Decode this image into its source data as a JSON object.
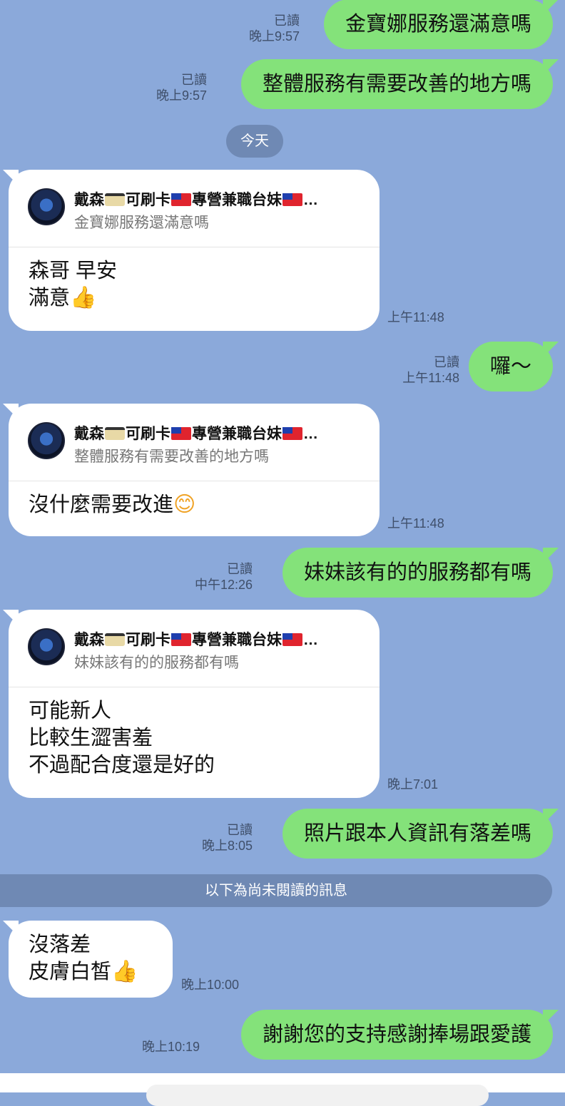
{
  "messages": {
    "m1": {
      "text": "金寶娜服務還滿意嗎",
      "read": "已讀",
      "time": "晚上9:57"
    },
    "m2": {
      "text": "整體服務有需要改善的地方嗎",
      "read": "已讀",
      "time": "晚上9:57"
    },
    "date_divider": "今天",
    "r1": {
      "name_a": "戴森",
      "name_b": "可刷卡",
      "name_c": "專營兼職台妹",
      "name_d": "…",
      "quote": "金寶娜服務還滿意嗎",
      "line1": "森哥 早安",
      "line2": "滿意",
      "time": "上午11:48"
    },
    "m3": {
      "text": "囉～",
      "read": "已讀",
      "time": "上午11:48"
    },
    "r2": {
      "name_a": "戴森",
      "name_b": "可刷卡",
      "name_c": "專營兼職台妹",
      "name_d": "…",
      "quote": "整體服務有需要改善的地方嗎",
      "line1": "沒什麼需要改進",
      "time": "上午11:48"
    },
    "m4": {
      "text": "妹妹該有的的服務都有嗎",
      "read": "已讀",
      "time": "中午12:26"
    },
    "r3": {
      "name_a": "戴森",
      "name_b": "可刷卡",
      "name_c": "專營兼職台妹",
      "name_d": "…",
      "quote": "妹妹該有的的服務都有嗎",
      "line1": "可能新人",
      "line2": "比較生澀害羞",
      "line3": "不過配合度還是好的",
      "time": "晚上7:01"
    },
    "m5": {
      "text": "照片跟本人資訊有落差嗎",
      "read": "已讀",
      "time": "晚上8:05"
    },
    "unread_divider": "以下為尚未閱讀的訊息",
    "r4": {
      "line1": "沒落差",
      "line2": "皮膚白皙",
      "time": "晚上10:00"
    },
    "m6": {
      "text": "謝謝您的支持感謝捧場跟愛護",
      "time": "晚上10:19"
    }
  },
  "icons": {
    "thumb": "thumbs-up-emoji",
    "smile": "smile-emoji",
    "card": "credit-card-emoji",
    "flag": "taiwan-flag-emoji"
  },
  "colors": {
    "outgoing": "#84e27a",
    "incoming": "#ffffff",
    "background": "#8ba9da",
    "divider": "#6f89b4"
  }
}
